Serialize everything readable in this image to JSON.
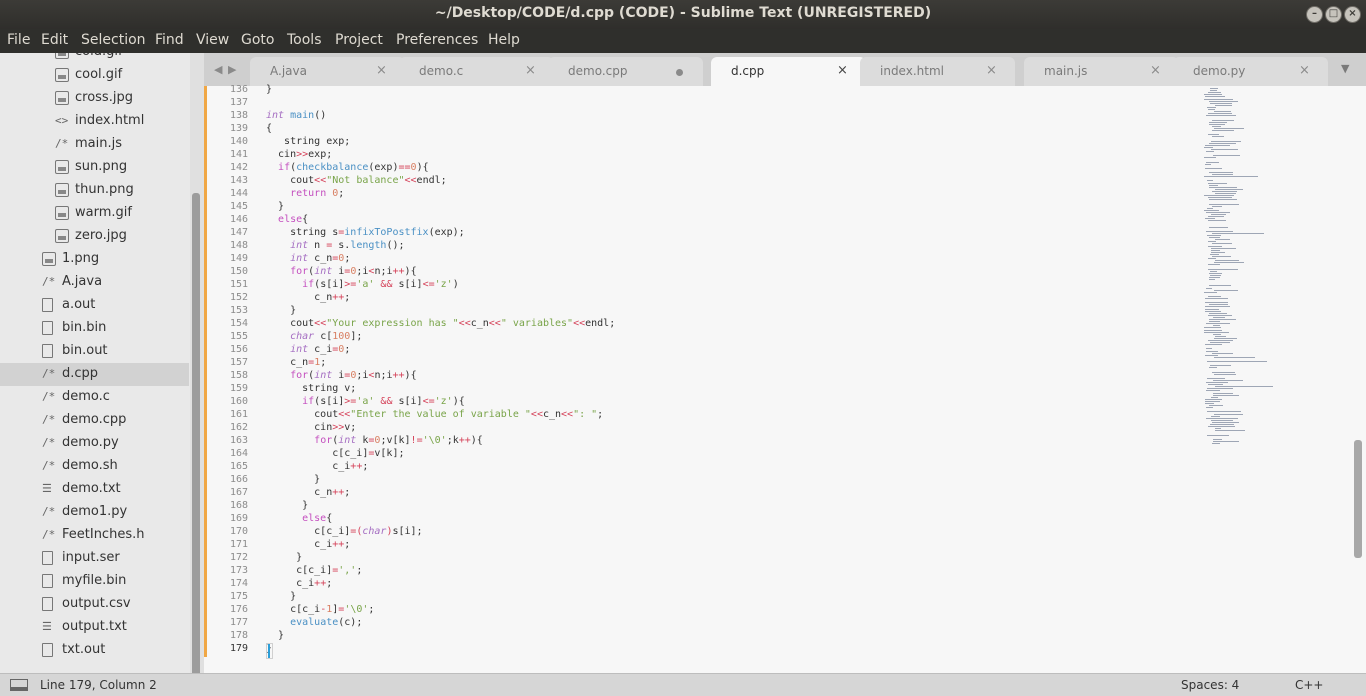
{
  "window": {
    "title": "~/Desktop/CODE/d.cpp (CODE) - Sublime Text (UNREGISTERED)",
    "minimize_icon": "minimize-icon",
    "maximize_icon": "maximize-icon",
    "close_icon": "close-icon"
  },
  "menu": [
    "File",
    "Edit",
    "Selection",
    "Find",
    "View",
    "Goto",
    "Tools",
    "Project",
    "Preferences",
    "Help"
  ],
  "sidebar": {
    "items": [
      {
        "label": "cold.gif",
        "icon": "image-icon"
      },
      {
        "label": "cool.gif",
        "icon": "image-icon"
      },
      {
        "label": "cross.jpg",
        "icon": "image-icon"
      },
      {
        "label": "index.html",
        "icon": "code-icon"
      },
      {
        "label": "main.js",
        "icon": "comment-icon"
      },
      {
        "label": "sun.png",
        "icon": "image-icon"
      },
      {
        "label": "thun.png",
        "icon": "image-icon"
      },
      {
        "label": "warm.gif",
        "icon": "image-icon"
      },
      {
        "label": "zero.jpg",
        "icon": "image-icon"
      },
      {
        "label": "1.png",
        "icon": "image-icon"
      },
      {
        "label": "A.java",
        "icon": "comment-icon"
      },
      {
        "label": "a.out",
        "icon": "file-icon"
      },
      {
        "label": "bin.bin",
        "icon": "file-icon"
      },
      {
        "label": "bin.out",
        "icon": "file-icon"
      },
      {
        "label": "d.cpp",
        "icon": "comment-icon",
        "selected": true
      },
      {
        "label": "demo.c",
        "icon": "comment-icon"
      },
      {
        "label": "demo.cpp",
        "icon": "comment-icon"
      },
      {
        "label": "demo.py",
        "icon": "comment-icon"
      },
      {
        "label": "demo.sh",
        "icon": "comment-icon"
      },
      {
        "label": "demo.txt",
        "icon": "text-lines-icon"
      },
      {
        "label": "demo1.py",
        "icon": "comment-icon"
      },
      {
        "label": "FeetInches.h",
        "icon": "comment-icon"
      },
      {
        "label": "input.ser",
        "icon": "file-icon"
      },
      {
        "label": "myfile.bin",
        "icon": "file-icon"
      },
      {
        "label": "output.csv",
        "icon": "file-icon"
      },
      {
        "label": "output.txt",
        "icon": "text-lines-icon"
      },
      {
        "label": "txt.out",
        "icon": "file-icon"
      }
    ]
  },
  "tabs": [
    {
      "label": "A.java",
      "state": "close"
    },
    {
      "label": "demo.c",
      "state": "close"
    },
    {
      "label": "demo.cpp",
      "state": "dirty"
    },
    {
      "label": "d.cpp",
      "state": "close",
      "active": true
    },
    {
      "label": "index.html",
      "state": "close"
    },
    {
      "label": "main.js",
      "state": "close"
    },
    {
      "label": "demo.py",
      "state": "close"
    }
  ],
  "editor": {
    "line_numbers": [
      "136",
      "137",
      "138",
      "139",
      "140",
      "141",
      "142",
      "143",
      "144",
      "145",
      "146",
      "147",
      "148",
      "149",
      "150",
      "151",
      "152",
      "153",
      "154",
      "155",
      "156",
      "157",
      "158",
      "159",
      "160",
      "161",
      "162",
      "163",
      "164",
      "165",
      "166",
      "167",
      "168",
      "169",
      "170",
      "171",
      "172",
      "173",
      "174",
      "175",
      "176",
      "177",
      "178",
      "179"
    ],
    "current_line": "179",
    "code_lines": [
      [
        [
          "p",
          "}"
        ]
      ],
      [],
      [
        [
          "ty",
          "int"
        ],
        [
          "p",
          " "
        ],
        [
          "fn",
          "main"
        ],
        [
          "p",
          "()"
        ]
      ],
      [
        [
          "p",
          "{"
        ]
      ],
      [
        [
          "p",
          "   string exp;"
        ]
      ],
      [
        [
          "p",
          "  cin"
        ],
        [
          "op",
          ">>"
        ],
        [
          "p",
          "exp;"
        ]
      ],
      [
        [
          "p",
          "  "
        ],
        [
          "kw",
          "if"
        ],
        [
          "p",
          "("
        ],
        [
          "fn",
          "checkbalance"
        ],
        [
          "p",
          "(exp)"
        ],
        [
          "op",
          "=="
        ],
        [
          "nu",
          "0"
        ],
        [
          "p",
          "){"
        ]
      ],
      [
        [
          "p",
          "    cout"
        ],
        [
          "op",
          "<<"
        ],
        [
          "st",
          "\"Not balance\""
        ],
        [
          "op",
          "<<"
        ],
        [
          "p",
          "endl;"
        ]
      ],
      [
        [
          "p",
          "    "
        ],
        [
          "kw",
          "return"
        ],
        [
          "p",
          " "
        ],
        [
          "nu",
          "0"
        ],
        [
          "p",
          ";"
        ]
      ],
      [
        [
          "p",
          "  }"
        ]
      ],
      [
        [
          "p",
          "  "
        ],
        [
          "kw",
          "else"
        ],
        [
          "p",
          "{"
        ]
      ],
      [
        [
          "p",
          "    string s"
        ],
        [
          "op",
          "="
        ],
        [
          "fn",
          "infixToPostfix"
        ],
        [
          "p",
          "(exp);"
        ]
      ],
      [
        [
          "p",
          "    "
        ],
        [
          "ty",
          "int"
        ],
        [
          "p",
          " n "
        ],
        [
          "op",
          "="
        ],
        [
          "p",
          " s."
        ],
        [
          "fn",
          "length"
        ],
        [
          "p",
          "();"
        ]
      ],
      [
        [
          "p",
          "    "
        ],
        [
          "ty",
          "int"
        ],
        [
          "p",
          " c_n"
        ],
        [
          "op",
          "="
        ],
        [
          "nu",
          "0"
        ],
        [
          "p",
          ";"
        ]
      ],
      [
        [
          "p",
          "    "
        ],
        [
          "kw",
          "for"
        ],
        [
          "p",
          "("
        ],
        [
          "ty",
          "int"
        ],
        [
          "p",
          " i"
        ],
        [
          "op",
          "="
        ],
        [
          "nu",
          "0"
        ],
        [
          "p",
          ";i"
        ],
        [
          "op",
          "<"
        ],
        [
          "p",
          "n;i"
        ],
        [
          "op",
          "++"
        ],
        [
          "p",
          "){"
        ]
      ],
      [
        [
          "p",
          "      "
        ],
        [
          "kw",
          "if"
        ],
        [
          "p",
          "(s[i]"
        ],
        [
          "op",
          ">="
        ],
        [
          "st",
          "'a'"
        ],
        [
          "p",
          " "
        ],
        [
          "op",
          "&&"
        ],
        [
          "p",
          " s[i]"
        ],
        [
          "op",
          "<="
        ],
        [
          "st",
          "'z'"
        ],
        [
          "p",
          ")"
        ]
      ],
      [
        [
          "p",
          "        c_n"
        ],
        [
          "op",
          "++"
        ],
        [
          "p",
          ";"
        ]
      ],
      [
        [
          "p",
          "    }"
        ]
      ],
      [
        [
          "p",
          "    cout"
        ],
        [
          "op",
          "<<"
        ],
        [
          "st",
          "\"Your expression has \""
        ],
        [
          "op",
          "<<"
        ],
        [
          "p",
          "c_n"
        ],
        [
          "op",
          "<<"
        ],
        [
          "st",
          "\" variables\""
        ],
        [
          "op",
          "<<"
        ],
        [
          "p",
          "endl;"
        ]
      ],
      [
        [
          "p",
          "    "
        ],
        [
          "ty",
          "char"
        ],
        [
          "p",
          " c["
        ],
        [
          "nu",
          "100"
        ],
        [
          "p",
          "];"
        ]
      ],
      [
        [
          "p",
          "    "
        ],
        [
          "ty",
          "int"
        ],
        [
          "p",
          " c_i"
        ],
        [
          "op",
          "="
        ],
        [
          "nu",
          "0"
        ],
        [
          "p",
          ";"
        ]
      ],
      [
        [
          "p",
          "    c_n"
        ],
        [
          "op",
          "="
        ],
        [
          "nu",
          "1"
        ],
        [
          "p",
          ";"
        ]
      ],
      [
        [
          "p",
          "    "
        ],
        [
          "kw",
          "for"
        ],
        [
          "p",
          "("
        ],
        [
          "ty",
          "int"
        ],
        [
          "p",
          " i"
        ],
        [
          "op",
          "="
        ],
        [
          "nu",
          "0"
        ],
        [
          "p",
          ";i"
        ],
        [
          "op",
          "<"
        ],
        [
          "p",
          "n;i"
        ],
        [
          "op",
          "++"
        ],
        [
          "p",
          "){"
        ]
      ],
      [
        [
          "p",
          "      string v;"
        ]
      ],
      [
        [
          "p",
          "      "
        ],
        [
          "kw",
          "if"
        ],
        [
          "p",
          "(s[i]"
        ],
        [
          "op",
          ">="
        ],
        [
          "st",
          "'a'"
        ],
        [
          "p",
          " "
        ],
        [
          "op",
          "&&"
        ],
        [
          "p",
          " s[i]"
        ],
        [
          "op",
          "<="
        ],
        [
          "st",
          "'z'"
        ],
        [
          "p",
          "){"
        ]
      ],
      [
        [
          "p",
          "        cout"
        ],
        [
          "op",
          "<<"
        ],
        [
          "st",
          "\"Enter the value of variable \""
        ],
        [
          "op",
          "<<"
        ],
        [
          "p",
          "c_n"
        ],
        [
          "op",
          "<<"
        ],
        [
          "st",
          "\": \""
        ],
        [
          "p",
          ";"
        ]
      ],
      [
        [
          "p",
          "        cin"
        ],
        [
          "op",
          ">>"
        ],
        [
          "p",
          "v;"
        ]
      ],
      [
        [
          "p",
          "        "
        ],
        [
          "kw",
          "for"
        ],
        [
          "p",
          "("
        ],
        [
          "ty",
          "int"
        ],
        [
          "p",
          " k"
        ],
        [
          "op",
          "="
        ],
        [
          "nu",
          "0"
        ],
        [
          "p",
          ";v[k]"
        ],
        [
          "op",
          "!="
        ],
        [
          "st",
          "'\\0'"
        ],
        [
          "p",
          ";k"
        ],
        [
          "op",
          "++"
        ],
        [
          "p",
          "){"
        ]
      ],
      [
        [
          "p",
          "           c[c_i]"
        ],
        [
          "op",
          "="
        ],
        [
          "p",
          "v[k];"
        ]
      ],
      [
        [
          "p",
          "           c_i"
        ],
        [
          "op",
          "++"
        ],
        [
          "p",
          ";"
        ]
      ],
      [
        [
          "p",
          "        }"
        ]
      ],
      [
        [
          "p",
          "        c_n"
        ],
        [
          "op",
          "++"
        ],
        [
          "p",
          ";"
        ]
      ],
      [
        [
          "p",
          "      }"
        ]
      ],
      [
        [
          "p",
          "      "
        ],
        [
          "kw",
          "else"
        ],
        [
          "p",
          "{"
        ]
      ],
      [
        [
          "p",
          "        c[c_i]"
        ],
        [
          "op",
          "=("
        ],
        [
          "ty",
          "char"
        ],
        [
          "op",
          ")"
        ],
        [
          "p",
          "s[i];"
        ]
      ],
      [
        [
          "p",
          "        c_i"
        ],
        [
          "op",
          "++"
        ],
        [
          "p",
          ";"
        ]
      ],
      [
        [
          "p",
          "     }"
        ]
      ],
      [
        [
          "p",
          "     c[c_i]"
        ],
        [
          "op",
          "="
        ],
        [
          "st",
          "','"
        ],
        [
          "p",
          ";"
        ]
      ],
      [
        [
          "p",
          "     c_i"
        ],
        [
          "op",
          "++"
        ],
        [
          "p",
          ";"
        ]
      ],
      [
        [
          "p",
          "    }"
        ]
      ],
      [
        [
          "p",
          "    c[c_i"
        ],
        [
          "op",
          "-"
        ],
        [
          "nu",
          "1"
        ],
        [
          "p",
          "]"
        ],
        [
          "op",
          "="
        ],
        [
          "st",
          "'\\0'"
        ],
        [
          "p",
          ";"
        ]
      ],
      [
        [
          "p",
          "    "
        ],
        [
          "fn",
          "evaluate"
        ],
        [
          "p",
          "(c);"
        ]
      ],
      [
        [
          "p",
          "  }"
        ]
      ],
      [
        [
          "p",
          "}"
        ]
      ]
    ]
  },
  "statusbar": {
    "position": "Line 179, Column 2",
    "indentation": "Spaces: 4",
    "syntax": "C++"
  },
  "colors": {
    "accent_modified": "#f0a745",
    "caret": "#2b9ed8"
  }
}
